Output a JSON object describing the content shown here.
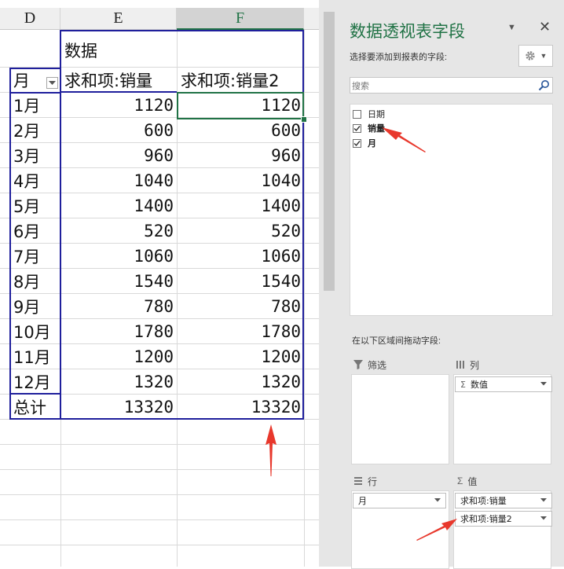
{
  "sheet": {
    "columns": [
      "D",
      "E",
      "F"
    ],
    "selected_column": "F",
    "header_label": "数据",
    "row_field": "月",
    "value_headers": [
      "求和项:销量",
      "求和项:销量2"
    ],
    "rows": [
      {
        "month": "1月",
        "v1": "1120",
        "v2": "1120"
      },
      {
        "month": "2月",
        "v1": "600",
        "v2": "600"
      },
      {
        "month": "3月",
        "v1": "960",
        "v2": "960"
      },
      {
        "month": "4月",
        "v1": "1040",
        "v2": "1040"
      },
      {
        "month": "5月",
        "v1": "1400",
        "v2": "1400"
      },
      {
        "month": "6月",
        "v1": "520",
        "v2": "520"
      },
      {
        "month": "7月",
        "v1": "1060",
        "v2": "1060"
      },
      {
        "month": "8月",
        "v1": "1540",
        "v2": "1540"
      },
      {
        "month": "9月",
        "v1": "780",
        "v2": "780"
      },
      {
        "month": "10月",
        "v1": "1780",
        "v2": "1780"
      },
      {
        "month": "11月",
        "v1": "1200",
        "v2": "1200"
      },
      {
        "month": "12月",
        "v1": "1320",
        "v2": "1320"
      }
    ],
    "total": {
      "label": "总计",
      "v1": "13320",
      "v2": "13320"
    }
  },
  "panel": {
    "title": "数据透视表字段",
    "subtitle": "选择要添加到报表的字段:",
    "search_placeholder": "搜索",
    "fields": [
      {
        "name": "日期",
        "checked": false,
        "bold": false
      },
      {
        "name": "销量",
        "checked": true,
        "bold": true
      },
      {
        "name": "月",
        "checked": true,
        "bold": true
      }
    ],
    "drag_hint": "在以下区域间拖动字段:",
    "areas": {
      "filters": {
        "title": "筛选",
        "items": []
      },
      "columns": {
        "title": "列",
        "items": [
          "数值"
        ]
      },
      "rows": {
        "title": "行",
        "items": [
          "月"
        ]
      },
      "values": {
        "title": "值",
        "items": [
          "求和项:销量",
          "求和项:销量2"
        ]
      }
    }
  },
  "icons": {
    "sum": "Σ",
    "close": "✕",
    "menu_dropdown": "▼",
    "settings": "gear-icon",
    "search": "magnifier-icon",
    "filter": "funnel-icon",
    "columns": "columns-icon",
    "rows": "rows-icon"
  },
  "colors": {
    "accent": "#217346",
    "pivot_border": "#1f1f9c",
    "arrow": "#e8382c"
  }
}
